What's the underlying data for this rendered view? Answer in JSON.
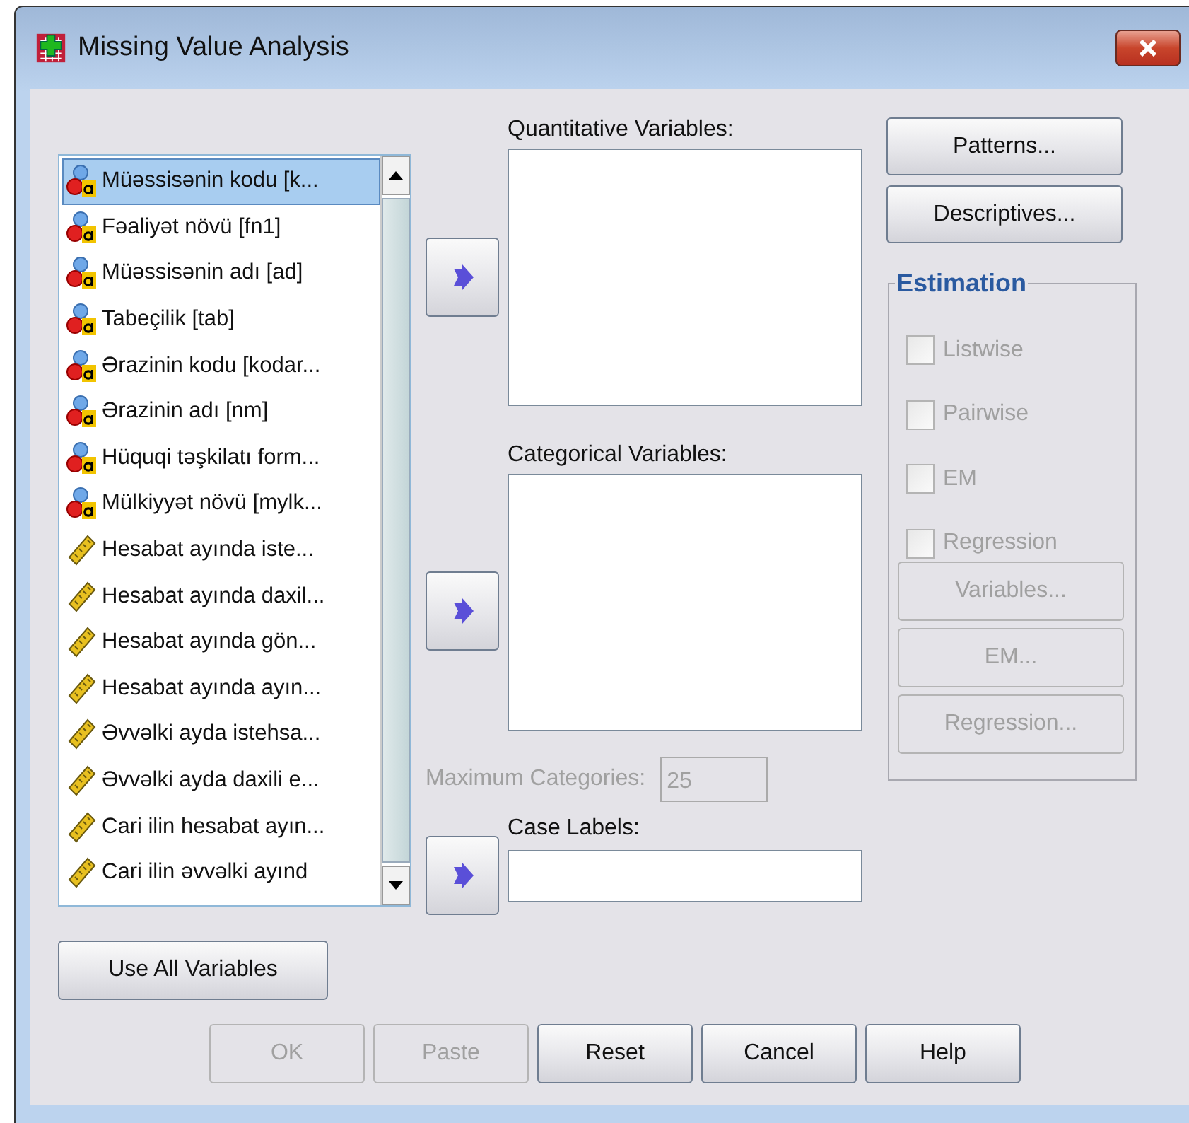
{
  "window": {
    "title": "Missing Value Analysis"
  },
  "variables": [
    {
      "label": "Müəssisənin kodu [k...",
      "kind": "nominal",
      "selected": true
    },
    {
      "label": "Fəaliyət növü [fn1]",
      "kind": "nominal",
      "selected": false
    },
    {
      "label": "Müəssisənin adı [ad]",
      "kind": "nominal",
      "selected": false
    },
    {
      "label": "Tabeçilik [tab]",
      "kind": "nominal",
      "selected": false
    },
    {
      "label": "Ərazinin kodu [kodar...",
      "kind": "nominal",
      "selected": false
    },
    {
      "label": "Ərazinin adı [nm]",
      "kind": "nominal",
      "selected": false
    },
    {
      "label": "Hüquqi təşkilatı form...",
      "kind": "nominal",
      "selected": false
    },
    {
      "label": "Mülkiyyət növü [mylk...",
      "kind": "nominal",
      "selected": false
    },
    {
      "label": "Hesabat ayında iste...",
      "kind": "scale",
      "selected": false
    },
    {
      "label": "Hesabat ayında daxil...",
      "kind": "scale",
      "selected": false
    },
    {
      "label": "Hesabat ayında gön...",
      "kind": "scale",
      "selected": false
    },
    {
      "label": "Hesabat ayında ayın...",
      "kind": "scale",
      "selected": false
    },
    {
      "label": "Əvvəlki ayda istehsa...",
      "kind": "scale",
      "selected": false
    },
    {
      "label": "Əvvəlki ayda daxili e...",
      "kind": "scale",
      "selected": false
    },
    {
      "label": "Cari ilin hesabat ayın...",
      "kind": "scale",
      "selected": false
    },
    {
      "label": "Cari ilin əvvəlki ayınd",
      "kind": "scale",
      "selected": false
    }
  ],
  "quantitative": {
    "label": "Quantitative Variables:"
  },
  "categorical": {
    "label": "Categorical Variables:"
  },
  "max_categories": {
    "label": "Maximum Categories:",
    "value": "25",
    "disabled": true
  },
  "case_labels": {
    "label": "Case Labels:"
  },
  "side_buttons": [
    {
      "label": "Patterns...",
      "disabled": false
    },
    {
      "label": "Descriptives...",
      "disabled": false
    }
  ],
  "estimation": {
    "title": "Estimation",
    "options": [
      {
        "label": "Listwise",
        "checked": false,
        "disabled": true
      },
      {
        "label": "Pairwise",
        "checked": false,
        "disabled": true
      },
      {
        "label": "EM",
        "checked": false,
        "disabled": true
      },
      {
        "label": "Regression",
        "checked": false,
        "disabled": true
      }
    ],
    "buttons": [
      {
        "label": "Variables...",
        "disabled": true
      },
      {
        "label": "EM...",
        "disabled": true
      },
      {
        "label": "Regression...",
        "disabled": true
      }
    ]
  },
  "use_all": {
    "label": "Use All Variables",
    "disabled": false
  },
  "buttons": [
    {
      "label": "OK",
      "disabled": true
    },
    {
      "label": "Paste",
      "disabled": true
    },
    {
      "label": "Reset",
      "disabled": false
    },
    {
      "label": "Cancel",
      "disabled": false
    },
    {
      "label": "Help",
      "disabled": false
    }
  ]
}
